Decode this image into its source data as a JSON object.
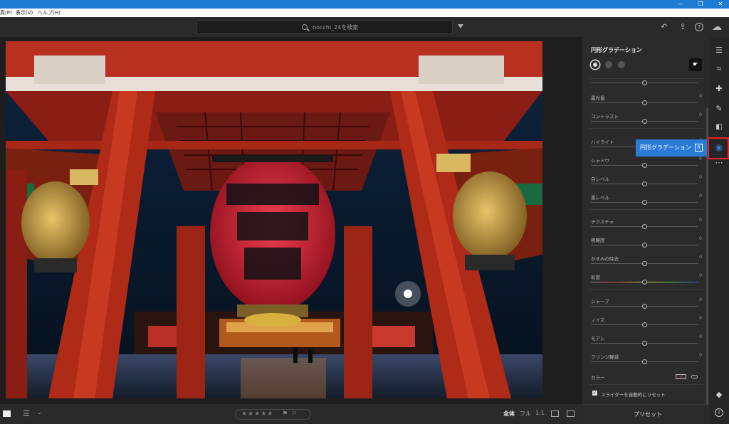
{
  "window": {
    "minimize": "—",
    "restore": "❐",
    "close": "✕"
  },
  "menu": {
    "items": [
      "真(P)",
      "表示(V)",
      "ヘルプ(H)"
    ]
  },
  "search": {
    "placeholder": "nocchi_24を検索"
  },
  "panel": {
    "title": "円形グラデーション",
    "groups": [
      {
        "sliders": [
          {
            "label": "",
            "value": ""
          },
          {
            "label": "露光量",
            "value": "0"
          },
          {
            "label": "コントラスト",
            "value": "0"
          }
        ]
      },
      {
        "sliders": [
          {
            "label": "ハイライト",
            "value": "0"
          },
          {
            "label": "シャドウ",
            "value": "0"
          },
          {
            "label": "白レベル",
            "value": "0"
          },
          {
            "label": "黒レベル",
            "value": "0"
          }
        ]
      },
      {
        "sliders": [
          {
            "label": "テクスチャ",
            "value": "0"
          },
          {
            "label": "明瞭度",
            "value": "0"
          },
          {
            "label": "かすみの除去",
            "value": "0"
          },
          {
            "label": "彩度",
            "value": "0"
          }
        ]
      },
      {
        "sliders": [
          {
            "label": "シャープ",
            "value": "0"
          },
          {
            "label": "ノイズ",
            "value": "0"
          },
          {
            "label": "モアレ",
            "value": "0"
          },
          {
            "label": "フリンジ軽減",
            "value": "0"
          }
        ]
      }
    ],
    "color_label": "カラー",
    "auto_reset_label": "スライダーを自動的にリセット"
  },
  "tooltip": {
    "label": "円形グラデーション",
    "shortcut": "R"
  },
  "bottom": {
    "stars": "★★★★★",
    "view_all": "全体",
    "view_fit": "フル",
    "view_1to1": "1:1"
  },
  "preset_label": "プリセット",
  "colors": {
    "accent": "#2a7bd7",
    "highlight_box": "#e8222a",
    "titlebar": "#1e7bd2"
  }
}
